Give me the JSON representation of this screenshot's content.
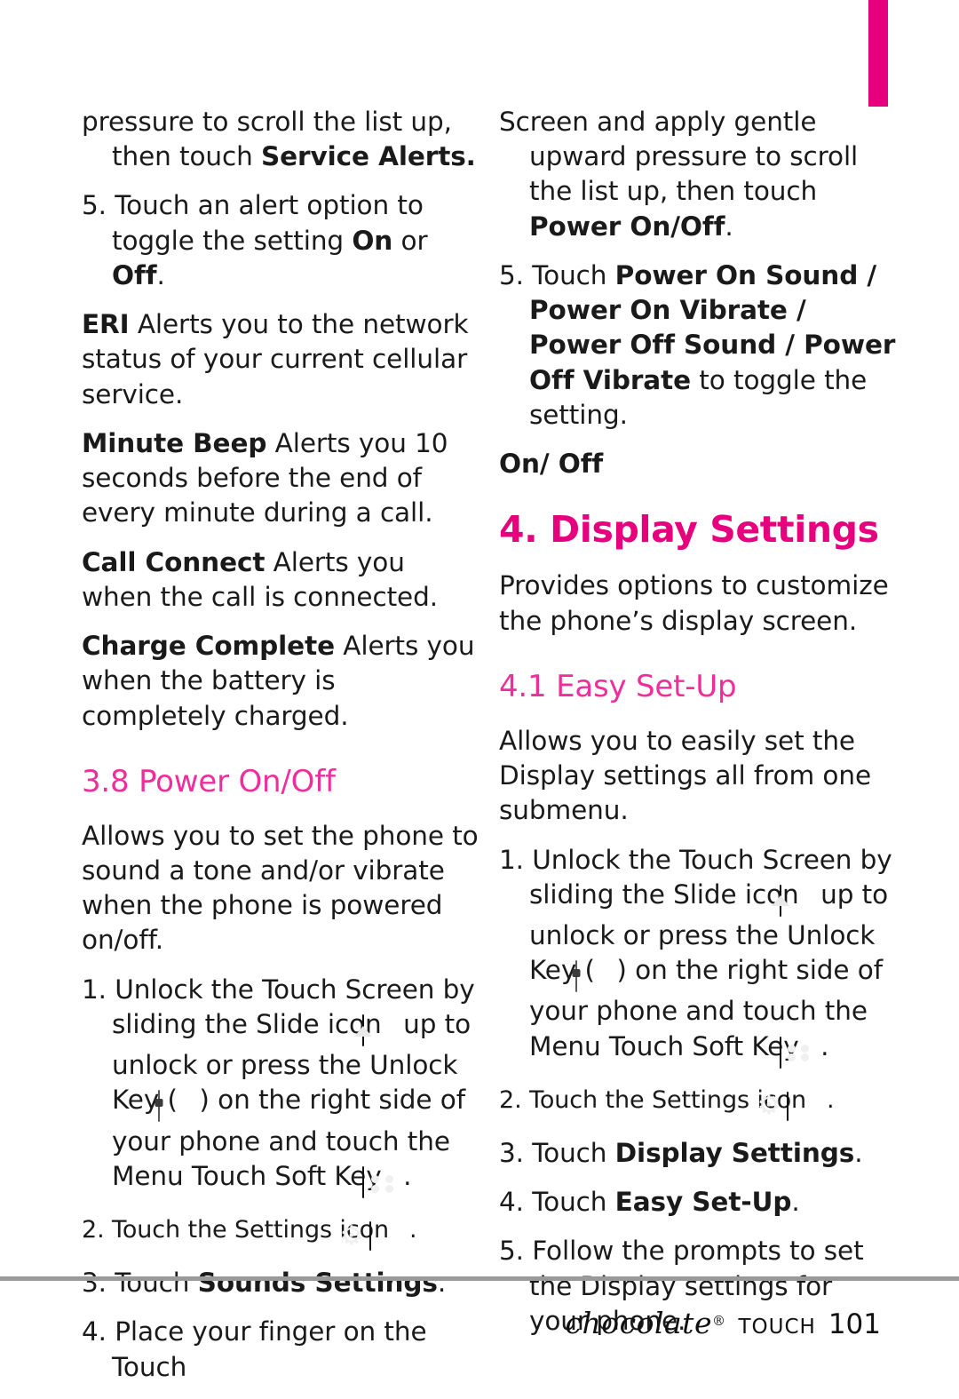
{
  "page": {
    "number": "101",
    "brand": "chocolate",
    "brand_mark": "®",
    "brand_sub": "TOUCH",
    "accent_color": "#e6007e"
  },
  "left_column": {
    "p1_a": "pressure to scroll the list up, then touch  ",
    "p1_b": "Service Alerts.",
    "p2_a": "5. Touch an alert option to toggle the setting ",
    "p2_b": "On",
    "p2_c": " or ",
    "p2_d": "Off",
    "p2_e": ".",
    "p3_b": "ERI",
    "p3_a": "  Alerts you to the network status of your current cellular service.",
    "p4_b": "Minute Beep",
    "p4_a": "  Alerts you 10 seconds before the end of every minute during a call.",
    "p5_b": "Call Connect",
    "p5_a": "  Alerts you when the call is connected.",
    "p6_b": "Charge Complete",
    "p6_a": "  Alerts you when the battery is completely charged.",
    "heading_38": "3.8 Power On/Off",
    "p7": "Allows you to set the phone to sound a tone and/or vibrate when the phone is powered on/off.",
    "step1_a": "1. Unlock the Touch Screen by sliding the Slide icon ",
    "step1_b": " up to unlock or press the Unlock Key ( ",
    "step1_c": " ) on the right side of your phone and touch the Menu Touch Soft Key ",
    "step1_d": " .",
    "step2_a": "2. Touch the Settings icon ",
    "step2_b": " .",
    "step3_a": "3. Touch ",
    "step3_b": "Sounds Settings",
    "step3_c": ".",
    "step4": "4. Place your finger on the Touch"
  },
  "right_column": {
    "p1_a": "Screen and apply gentle upward pressure to scroll the list up, then touch ",
    "p1_b": "Power On/Off",
    "p1_c": ".",
    "p2_a": "5. Touch ",
    "p2_b": "Power On Sound / Power On Vibrate / Power Off Sound / Power Off Vibrate",
    "p2_c": " to toggle the setting.",
    "p3": "On/ Off",
    "heading_4": "4. Display Settings",
    "p4": "Provides options to customize the phone’s display screen.",
    "heading_41": "4.1 Easy Set-Up",
    "p5": "Allows you to easily set the Display settings all from one submenu.",
    "step1_a": "1. Unlock the Touch Screen by sliding the Slide icon ",
    "step1_b": " up to unlock or press the Unlock Key ( ",
    "step1_c": " ) on the right side of your phone and touch the Menu Touch Soft Key ",
    "step1_d": " .",
    "step2_a": "2. Touch the Settings icon ",
    "step2_b": " .",
    "step3_a": "3. Touch ",
    "step3_b": "Display Settings",
    "step3_c": ".",
    "step4_a": "4. Touch ",
    "step4_b": "Easy Set-Up",
    "step4_c": ".",
    "step5": "5.  Follow the prompts to set the Display settings for your phone."
  }
}
